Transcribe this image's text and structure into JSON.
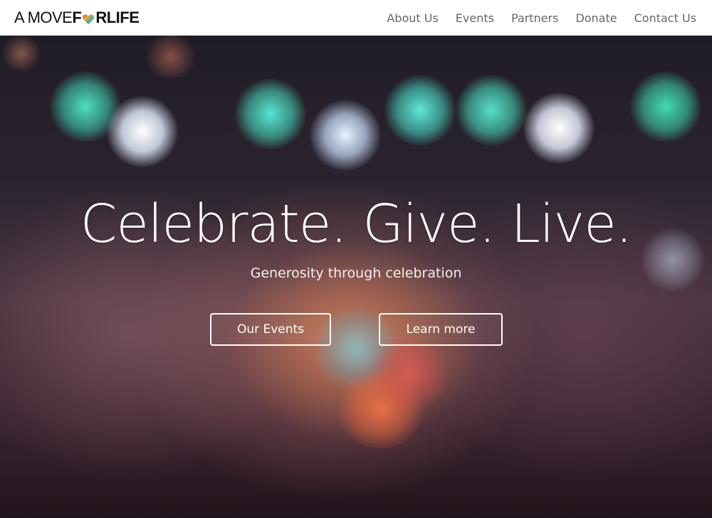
{
  "brand": {
    "part_a": "A MOVE ",
    "part_f": "F",
    "part_o_icon": "heart-icon",
    "part_r": "R",
    "part_life": " LIFE"
  },
  "nav": {
    "items": [
      {
        "label": "About Us"
      },
      {
        "label": "Events"
      },
      {
        "label": "Partners"
      },
      {
        "label": "Donate"
      },
      {
        "label": "Contact Us"
      }
    ]
  },
  "hero": {
    "headline": "Celebrate. Give. Live.",
    "subhead": "Generosity through celebration",
    "buttons": {
      "events_label": "Our Events",
      "learn_label": "Learn more"
    }
  },
  "colors": {
    "nav_bg": "#ffffff",
    "nav_text": "#666666",
    "hero_text": "#ffffff",
    "bokeh_teal": "#3fd6b4",
    "bokeh_white": "#ffffff"
  }
}
